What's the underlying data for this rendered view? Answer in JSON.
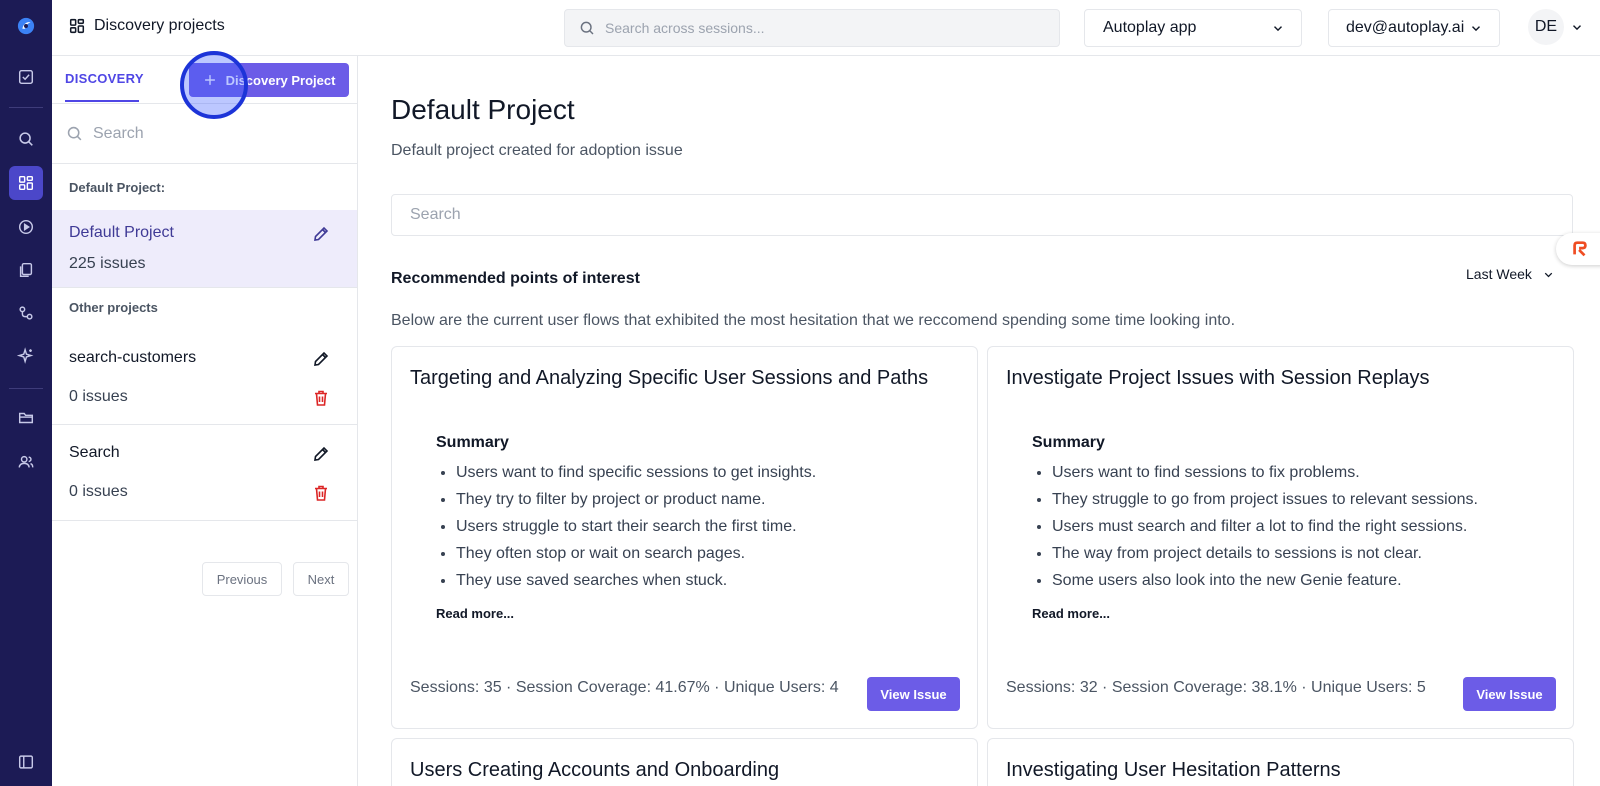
{
  "header": {
    "title": "Discovery projects",
    "search_placeholder": "Search across sessions...",
    "app_select": "Autoplay app",
    "user_select": "dev@autoplay.ai",
    "avatar_initials": "DE"
  },
  "rail": {
    "items": [
      "logo-icon",
      "checkbox-icon",
      "search-icon",
      "dashboard-icon",
      "play-icon",
      "copy-icon",
      "flow-icon",
      "sparkle-icon",
      "folder-icon",
      "users-icon",
      "sidebar-toggle-icon"
    ],
    "active": "dashboard-icon"
  },
  "panel": {
    "tab_label": "DISCOVERY",
    "add_button_label": "Discovery Project",
    "search_placeholder": "Search",
    "default_section": "Default Project:",
    "other_section": "Other projects",
    "projects": [
      {
        "name": "Default Project",
        "issues": "225 issues"
      },
      {
        "name": "search-customers",
        "issues": "0 issues"
      },
      {
        "name": "Search",
        "issues": "0 issues"
      }
    ],
    "prev_label": "Previous",
    "next_label": "Next"
  },
  "main": {
    "title": "Default Project",
    "subtitle": "Default project created for adoption issue",
    "search_placeholder": "Search",
    "rec_title": "Recommended points of interest",
    "range": "Last Week",
    "rec_desc": "Below are the current user flows that exhibited the most hesitation that we reccomend spending some time looking into.",
    "cards": [
      {
        "title": "Targeting and Analyzing Specific User Sessions and Paths",
        "summary_label": "Summary",
        "bullets": [
          "Users want to find specific sessions to get insights.",
          "They try to filter by project or product name.",
          "Users struggle to start their search the first time.",
          "They often stop or wait on search pages.",
          "They use saved searches when stuck."
        ],
        "read_more": "Read more...",
        "stats": "Sessions: 35 · Session Coverage: 41.67% · Unique Users: 4",
        "button": "View Issue"
      },
      {
        "title": "Investigate Project Issues with Session Replays",
        "summary_label": "Summary",
        "bullets": [
          "Users want to find sessions to fix problems.",
          "They struggle to go from project issues to relevant sessions.",
          "Users must search and filter a lot to find the right sessions.",
          "The way from project details to sessions is not clear.",
          "Some users also look into the new Genie feature."
        ],
        "read_more": "Read more...",
        "stats": "Sessions: 32 · Session Coverage: 38.1% · Unique Users: 5",
        "button": "View Issue"
      },
      {
        "title": "Users Creating Accounts and Onboarding"
      },
      {
        "title": "Investigating User Hesitation Patterns"
      }
    ]
  },
  "colors": {
    "rail_bg": "#1c1b55",
    "accent": "#6c5ce7",
    "tab_accent": "#4f46e5",
    "delete": "#dc2626",
    "selected_bg": "#eeecfb"
  }
}
